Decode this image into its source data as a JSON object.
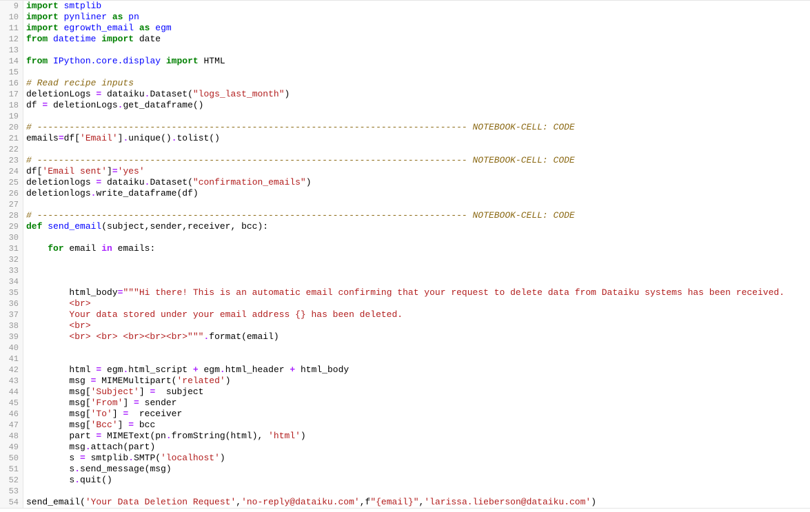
{
  "first_line": 9,
  "lines": [
    {
      "n": 9,
      "segs": [
        {
          "t": "import ",
          "c": "kw"
        },
        {
          "t": "smtplib",
          "c": "mod"
        }
      ]
    },
    {
      "n": 10,
      "segs": [
        {
          "t": "import ",
          "c": "kw"
        },
        {
          "t": "pynliner",
          "c": "mod"
        },
        {
          "t": " ",
          "c": ""
        },
        {
          "t": "as",
          "c": "kw"
        },
        {
          "t": " ",
          "c": ""
        },
        {
          "t": "pn",
          "c": "mod"
        }
      ]
    },
    {
      "n": 11,
      "segs": [
        {
          "t": "import ",
          "c": "kw"
        },
        {
          "t": "egrowth_email",
          "c": "mod"
        },
        {
          "t": " ",
          "c": ""
        },
        {
          "t": "as",
          "c": "kw"
        },
        {
          "t": " ",
          "c": ""
        },
        {
          "t": "egm",
          "c": "mod"
        }
      ]
    },
    {
      "n": 12,
      "segs": [
        {
          "t": "from ",
          "c": "kw"
        },
        {
          "t": "datetime",
          "c": "mod"
        },
        {
          "t": " ",
          "c": ""
        },
        {
          "t": "import",
          "c": "kw"
        },
        {
          "t": " ",
          "c": ""
        },
        {
          "t": "date",
          "c": ""
        }
      ]
    },
    {
      "n": 13,
      "segs": [
        {
          "t": "",
          "c": ""
        }
      ]
    },
    {
      "n": 14,
      "segs": [
        {
          "t": "from ",
          "c": "kw"
        },
        {
          "t": "IPython.core.display",
          "c": "mod"
        },
        {
          "t": " ",
          "c": ""
        },
        {
          "t": "import",
          "c": "kw"
        },
        {
          "t": " ",
          "c": ""
        },
        {
          "t": "HTML",
          "c": ""
        }
      ]
    },
    {
      "n": 15,
      "segs": [
        {
          "t": "",
          "c": ""
        }
      ]
    },
    {
      "n": 16,
      "segs": [
        {
          "t": "# Read recipe inputs",
          "c": "com"
        }
      ]
    },
    {
      "n": 17,
      "segs": [
        {
          "t": "deletionLogs ",
          "c": ""
        },
        {
          "t": "=",
          "c": "op"
        },
        {
          "t": " dataiku",
          "c": ""
        },
        {
          "t": ".",
          "c": "op"
        },
        {
          "t": "Dataset(",
          "c": ""
        },
        {
          "t": "\"logs_last_month\"",
          "c": "str"
        },
        {
          "t": ")",
          "c": ""
        }
      ]
    },
    {
      "n": 18,
      "segs": [
        {
          "t": "df ",
          "c": ""
        },
        {
          "t": "=",
          "c": "op"
        },
        {
          "t": " deletionLogs",
          "c": ""
        },
        {
          "t": ".",
          "c": "op"
        },
        {
          "t": "get_dataframe()",
          "c": ""
        }
      ]
    },
    {
      "n": 19,
      "segs": [
        {
          "t": "",
          "c": ""
        }
      ]
    },
    {
      "n": 20,
      "segs": [
        {
          "t": "# -------------------------------------------------------------------------------- NOTEBOOK-CELL: CODE",
          "c": "com"
        }
      ]
    },
    {
      "n": 21,
      "segs": [
        {
          "t": "emails",
          "c": ""
        },
        {
          "t": "=",
          "c": "op"
        },
        {
          "t": "df[",
          "c": ""
        },
        {
          "t": "'Email'",
          "c": "str"
        },
        {
          "t": "]",
          "c": ""
        },
        {
          "t": ".",
          "c": "op"
        },
        {
          "t": "unique()",
          "c": ""
        },
        {
          "t": ".",
          "c": "op"
        },
        {
          "t": "tolist()",
          "c": ""
        }
      ]
    },
    {
      "n": 22,
      "segs": [
        {
          "t": "",
          "c": ""
        }
      ]
    },
    {
      "n": 23,
      "segs": [
        {
          "t": "# -------------------------------------------------------------------------------- NOTEBOOK-CELL: CODE",
          "c": "com"
        }
      ]
    },
    {
      "n": 24,
      "segs": [
        {
          "t": "df[",
          "c": ""
        },
        {
          "t": "'Email sent'",
          "c": "str"
        },
        {
          "t": "]",
          "c": ""
        },
        {
          "t": "=",
          "c": "op"
        },
        {
          "t": "'yes'",
          "c": "str"
        }
      ]
    },
    {
      "n": 25,
      "segs": [
        {
          "t": "deletionlogs ",
          "c": ""
        },
        {
          "t": "=",
          "c": "op"
        },
        {
          "t": " dataiku",
          "c": ""
        },
        {
          "t": ".",
          "c": "op"
        },
        {
          "t": "Dataset(",
          "c": ""
        },
        {
          "t": "\"confirmation_emails\"",
          "c": "str"
        },
        {
          "t": ")",
          "c": ""
        }
      ]
    },
    {
      "n": 26,
      "segs": [
        {
          "t": "deletionlogs",
          "c": ""
        },
        {
          "t": ".",
          "c": "op"
        },
        {
          "t": "write_dataframe(df)",
          "c": ""
        }
      ]
    },
    {
      "n": 27,
      "segs": [
        {
          "t": "",
          "c": ""
        }
      ]
    },
    {
      "n": 28,
      "segs": [
        {
          "t": "# -------------------------------------------------------------------------------- NOTEBOOK-CELL: CODE",
          "c": "com"
        }
      ]
    },
    {
      "n": 29,
      "segs": [
        {
          "t": "def ",
          "c": "kw"
        },
        {
          "t": "send_email",
          "c": "def"
        },
        {
          "t": "(subject,sender,receiver, bcc):",
          "c": ""
        }
      ]
    },
    {
      "n": 30,
      "segs": [
        {
          "t": "",
          "c": ""
        }
      ]
    },
    {
      "n": 31,
      "segs": [
        {
          "t": "    ",
          "c": ""
        },
        {
          "t": "for",
          "c": "kw"
        },
        {
          "t": " email ",
          "c": ""
        },
        {
          "t": "in",
          "c": "op"
        },
        {
          "t": " emails:",
          "c": ""
        }
      ]
    },
    {
      "n": 32,
      "segs": [
        {
          "t": "",
          "c": ""
        }
      ]
    },
    {
      "n": 33,
      "segs": [
        {
          "t": "",
          "c": ""
        }
      ]
    },
    {
      "n": 34,
      "segs": [
        {
          "t": "",
          "c": ""
        }
      ]
    },
    {
      "n": 35,
      "segs": [
        {
          "t": "        html_body",
          "c": ""
        },
        {
          "t": "=",
          "c": "op"
        },
        {
          "t": "\"\"\"Hi there! This is an automatic email confirming that your request to delete data from Dataiku systems has been received.",
          "c": "str"
        }
      ]
    },
    {
      "n": 36,
      "segs": [
        {
          "t": "        <br>",
          "c": "str"
        }
      ]
    },
    {
      "n": 37,
      "segs": [
        {
          "t": "        Your data stored under your email address {} has been deleted.",
          "c": "str"
        }
      ]
    },
    {
      "n": 38,
      "segs": [
        {
          "t": "        <br>",
          "c": "str"
        }
      ]
    },
    {
      "n": 39,
      "segs": [
        {
          "t": "        <br> <br> <br><br><br>\"\"\"",
          "c": "str"
        },
        {
          "t": ".",
          "c": "op"
        },
        {
          "t": "format(email)",
          "c": ""
        }
      ]
    },
    {
      "n": 40,
      "segs": [
        {
          "t": "",
          "c": ""
        }
      ]
    },
    {
      "n": 41,
      "segs": [
        {
          "t": "",
          "c": ""
        }
      ]
    },
    {
      "n": 42,
      "segs": [
        {
          "t": "        html ",
          "c": ""
        },
        {
          "t": "=",
          "c": "op"
        },
        {
          "t": " egm",
          "c": ""
        },
        {
          "t": ".",
          "c": "op"
        },
        {
          "t": "html_script ",
          "c": ""
        },
        {
          "t": "+",
          "c": "op"
        },
        {
          "t": " egm",
          "c": ""
        },
        {
          "t": ".",
          "c": "op"
        },
        {
          "t": "html_header ",
          "c": ""
        },
        {
          "t": "+",
          "c": "op"
        },
        {
          "t": " html_body",
          "c": ""
        }
      ]
    },
    {
      "n": 43,
      "segs": [
        {
          "t": "        msg ",
          "c": ""
        },
        {
          "t": "=",
          "c": "op"
        },
        {
          "t": " MIMEMultipart(",
          "c": ""
        },
        {
          "t": "'related'",
          "c": "str"
        },
        {
          "t": ")",
          "c": ""
        }
      ]
    },
    {
      "n": 44,
      "segs": [
        {
          "t": "        msg[",
          "c": ""
        },
        {
          "t": "'Subject'",
          "c": "str"
        },
        {
          "t": "] ",
          "c": ""
        },
        {
          "t": "=",
          "c": "op"
        },
        {
          "t": "  subject",
          "c": ""
        }
      ]
    },
    {
      "n": 45,
      "segs": [
        {
          "t": "        msg[",
          "c": ""
        },
        {
          "t": "'From'",
          "c": "str"
        },
        {
          "t": "] ",
          "c": ""
        },
        {
          "t": "=",
          "c": "op"
        },
        {
          "t": " sender",
          "c": ""
        }
      ]
    },
    {
      "n": 46,
      "segs": [
        {
          "t": "        msg[",
          "c": ""
        },
        {
          "t": "'To'",
          "c": "str"
        },
        {
          "t": "] ",
          "c": ""
        },
        {
          "t": "=",
          "c": "op"
        },
        {
          "t": "  receiver",
          "c": ""
        }
      ]
    },
    {
      "n": 47,
      "segs": [
        {
          "t": "        msg[",
          "c": ""
        },
        {
          "t": "'Bcc'",
          "c": "str"
        },
        {
          "t": "] ",
          "c": ""
        },
        {
          "t": "=",
          "c": "op"
        },
        {
          "t": " bcc",
          "c": ""
        }
      ]
    },
    {
      "n": 48,
      "segs": [
        {
          "t": "        part ",
          "c": ""
        },
        {
          "t": "=",
          "c": "op"
        },
        {
          "t": " MIMEText(pn",
          "c": ""
        },
        {
          "t": ".",
          "c": "op"
        },
        {
          "t": "fromString(html), ",
          "c": ""
        },
        {
          "t": "'html'",
          "c": "str"
        },
        {
          "t": ")",
          "c": ""
        }
      ]
    },
    {
      "n": 49,
      "segs": [
        {
          "t": "        msg",
          "c": ""
        },
        {
          "t": ".",
          "c": "op"
        },
        {
          "t": "attach(part)",
          "c": ""
        }
      ]
    },
    {
      "n": 50,
      "segs": [
        {
          "t": "        s ",
          "c": ""
        },
        {
          "t": "=",
          "c": "op"
        },
        {
          "t": " smtplib",
          "c": ""
        },
        {
          "t": ".",
          "c": "op"
        },
        {
          "t": "SMTP(",
          "c": ""
        },
        {
          "t": "'localhost'",
          "c": "str"
        },
        {
          "t": ")",
          "c": ""
        }
      ]
    },
    {
      "n": 51,
      "segs": [
        {
          "t": "        s",
          "c": ""
        },
        {
          "t": ".",
          "c": "op"
        },
        {
          "t": "send_message(msg)",
          "c": ""
        }
      ]
    },
    {
      "n": 52,
      "segs": [
        {
          "t": "        s",
          "c": ""
        },
        {
          "t": ".",
          "c": "op"
        },
        {
          "t": "quit()",
          "c": ""
        }
      ]
    },
    {
      "n": 53,
      "segs": [
        {
          "t": "",
          "c": ""
        }
      ]
    },
    {
      "n": 54,
      "segs": [
        {
          "t": "send_email(",
          "c": ""
        },
        {
          "t": "'Your Data Deletion Request'",
          "c": "str"
        },
        {
          "t": ",",
          "c": ""
        },
        {
          "t": "'no-reply@dataiku.com'",
          "c": "str"
        },
        {
          "t": ",f",
          "c": ""
        },
        {
          "t": "\"{email}\"",
          "c": "str"
        },
        {
          "t": ",",
          "c": ""
        },
        {
          "t": "'larissa.lieberson@dataiku.com'",
          "c": "str"
        },
        {
          "t": ")",
          "c": ""
        }
      ]
    }
  ]
}
